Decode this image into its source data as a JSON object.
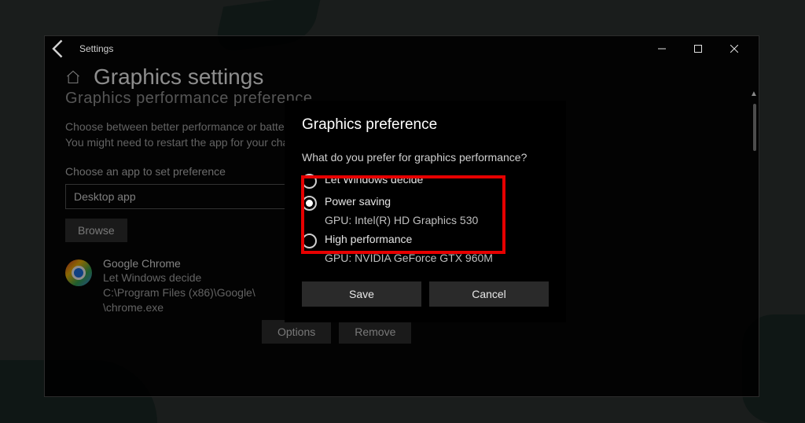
{
  "window": {
    "title": "Settings",
    "page_title": "Graphics settings",
    "subhead": "Graphics performance preference",
    "description_line1": "Choose between better performance or battery life when using an app.",
    "description_line2": "You might need to restart the app for your changes to take effect.",
    "choose_label": "Choose an app to set preference",
    "select_value": "Desktop app",
    "browse_label": "Browse",
    "app": {
      "name": "Google Chrome",
      "pref": "Let Windows decide",
      "path_line1": "C:\\Program Files (x86)\\Google\\",
      "path_line2": "\\chrome.exe"
    },
    "options_label": "Options",
    "remove_label": "Remove"
  },
  "modal": {
    "title": "Graphics preference",
    "prompt": "What do you prefer for graphics performance?",
    "options": [
      {
        "label": "Let Windows decide",
        "sub": "",
        "checked": false
      },
      {
        "label": "Power saving",
        "sub": "GPU: Intel(R) HD Graphics 530",
        "checked": true
      },
      {
        "label": "High performance",
        "sub": "GPU: NVIDIA GeForce GTX 960M",
        "checked": false
      }
    ],
    "save_label": "Save",
    "cancel_label": "Cancel"
  }
}
